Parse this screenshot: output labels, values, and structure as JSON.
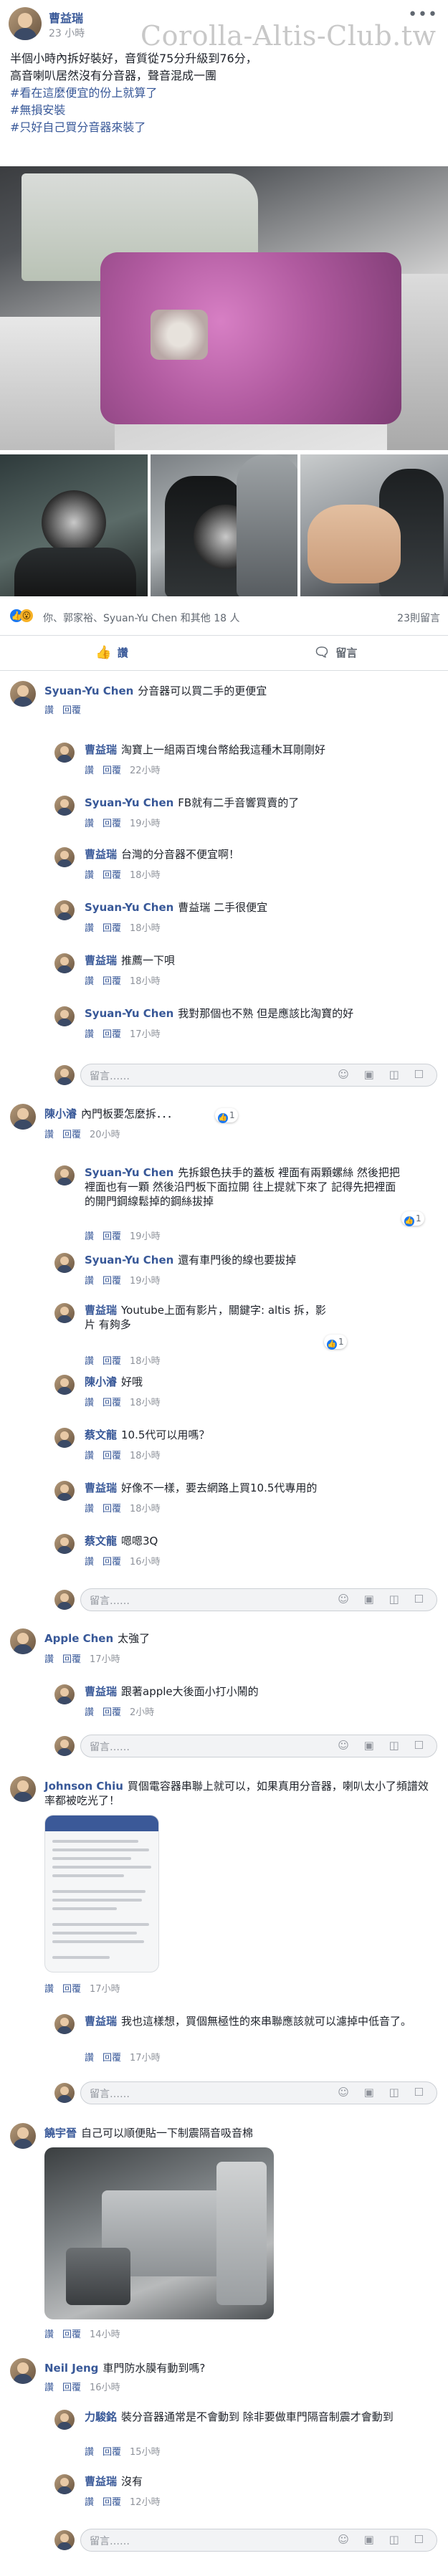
{
  "post": {
    "author": "曹益瑞",
    "time": "23 小時",
    "watermark": "Corolla-Altis-Club.tw",
    "lines": [
      "半個小時內拆好裝好，音質從75分升級到76分，",
      "高音喇叭居然沒有分音器，聲音混成一團"
    ],
    "hashtags": [
      "#看在這麼便宜的份上就算了",
      "#無損安裝",
      "#只好自己買分音器來裝了"
    ]
  },
  "reactions": {
    "summary": "你、郭家裕、Syuan-Yu Chen 和其他 18 人",
    "comments": "23則留言"
  },
  "actions": {
    "like": "讚",
    "comment": "留言"
  },
  "reply_placeholder": "留言……",
  "reply_tools": "☺ ▣ ◫ ☐",
  "comments": [
    {
      "name": "Syuan-Yu Chen",
      "text": "分音器可以買二手的更便宜",
      "time": ""
    },
    {
      "name": "曹益瑞",
      "text": "淘寶上一組兩百塊台幣給我這種木耳剛剛好",
      "time": "22小時"
    },
    {
      "name": "Syuan-Yu Chen",
      "text": "FB就有二手音響買賣的了",
      "time": "19小時"
    },
    {
      "name": "曹益瑞",
      "text": "台灣的分音器不便宜啊！",
      "time": "18小時"
    },
    {
      "name": "Syuan-Yu Chen",
      "text": "曹益瑞 二手很便宜",
      "time": "18小時"
    },
    {
      "name": "曹益瑞",
      "text": "推薦一下唄",
      "time": "18小時"
    },
    {
      "name": "Syuan-Yu Chen",
      "text": "我對那個也不熟 但是應該比淘寶的好",
      "time": "17小時"
    },
    {
      "name": "陳小濬",
      "text": "內門板要怎麼拆．．．",
      "time": "20小時",
      "likes": "1"
    },
    {
      "name": "Syuan-Yu Chen",
      "text": "先拆銀色扶手的蓋板 裡面有兩顆螺絲 然後把把裡面也有一顆 然後沿門板下面拉開 往上提就下來了 記得先把裡面的開門鋼線鬆掉的鋼絲拔掉",
      "time": "19小時",
      "likes": "1"
    },
    {
      "name": "Syuan-Yu Chen",
      "text": "還有車門後的線也要拔掉",
      "time": "19小時"
    },
    {
      "name": "曹益瑞",
      "text": "Youtube上面有影片，關鍵字: altis 拆，影片 有夠多",
      "time": "18小時",
      "likes": "1"
    },
    {
      "name": "陳小濬",
      "text": "好哦",
      "time": "18小時"
    },
    {
      "name": "蔡文龍",
      "text": "10.5代可以用嗎？",
      "time": "18小時"
    },
    {
      "name": "曹益瑞",
      "text": "好像不一樣，要去網路上買10.5代專用的",
      "time": "18小時"
    },
    {
      "name": "蔡文龍",
      "text": "嗯嗯3Q",
      "time": "16小時"
    },
    {
      "name": "Apple Chen",
      "text": "太強了",
      "time": "17小時"
    },
    {
      "name": "曹益瑞",
      "text": "跟著apple大後面小打小鬧的",
      "time": "2小時"
    },
    {
      "name": "Johnson Chiu",
      "text": "買個電容器串聯上就可以，如果真用分音器，喇叭太小了頻譜效率都被吃光了！",
      "time": "17小時"
    },
    {
      "name": "曹益瑞",
      "text": "我也這樣想，買個無極性的來串聯應該就可以濾掉中低音了。",
      "time": "17小時"
    },
    {
      "name": "饒宇晉",
      "text": "自己可以順便貼一下制震隔音吸音棉",
      "time": "14小時"
    },
    {
      "name": "Neil Jeng",
      "text": "車門防水膜有動到嗎?",
      "time": "16小時"
    },
    {
      "name": "力駿銘",
      "text": "裝分音器通常是不會動到 除非要做車門隔音制震才會動到",
      "time": "15小時"
    },
    {
      "name": "曹益瑞",
      "text": "沒有",
      "time": "12小時"
    }
  ],
  "comment_actions": {
    "like": "讚",
    "reply": "回覆"
  }
}
